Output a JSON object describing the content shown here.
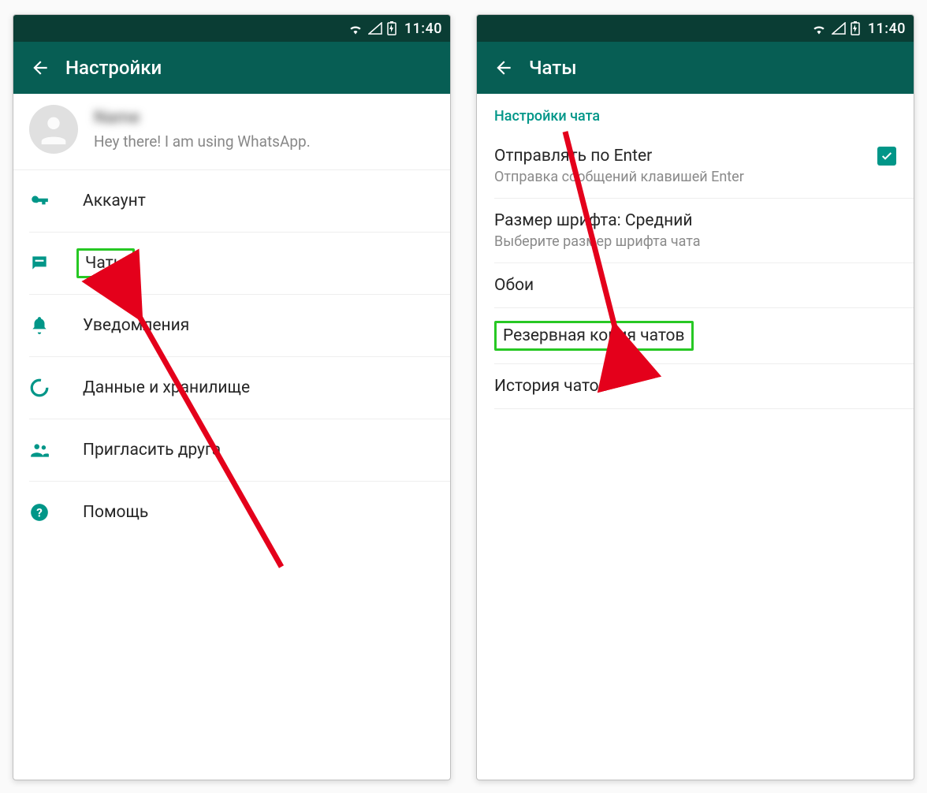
{
  "status": {
    "time": "11:40"
  },
  "colors": {
    "brand_dark": "#075e54",
    "brand_status": "#0a3d34",
    "accent": "#009688",
    "highlight": "#27c824",
    "arrow": "#e4001b"
  },
  "left": {
    "title": "Настройки",
    "profile": {
      "name_blurred": "Name",
      "status": "Hey there! I am using WhatsApp."
    },
    "items": [
      {
        "icon": "key-icon",
        "label": "Аккаунт"
      },
      {
        "icon": "chat-icon",
        "label": "Чаты"
      },
      {
        "icon": "bell-icon",
        "label": "Уведомления"
      },
      {
        "icon": "data-icon",
        "label": "Данные и хранилище"
      },
      {
        "icon": "people-icon",
        "label": "Пригласить друга"
      },
      {
        "icon": "help-icon",
        "label": "Помощь"
      }
    ],
    "highlighted_index": 1
  },
  "right": {
    "title": "Чаты",
    "section_header": "Настройки чата",
    "items": [
      {
        "title": "Отправлять по Enter",
        "sub": "Отправка сообщений клавишей Enter",
        "checkbox": true
      },
      {
        "title": "Размер шрифта: Средний",
        "sub": "Выберите размер шрифта чата"
      },
      {
        "title": "Обои"
      },
      {
        "title": "Резервная копия чатов"
      },
      {
        "title": "История чатов"
      }
    ],
    "highlighted_index": 3
  }
}
